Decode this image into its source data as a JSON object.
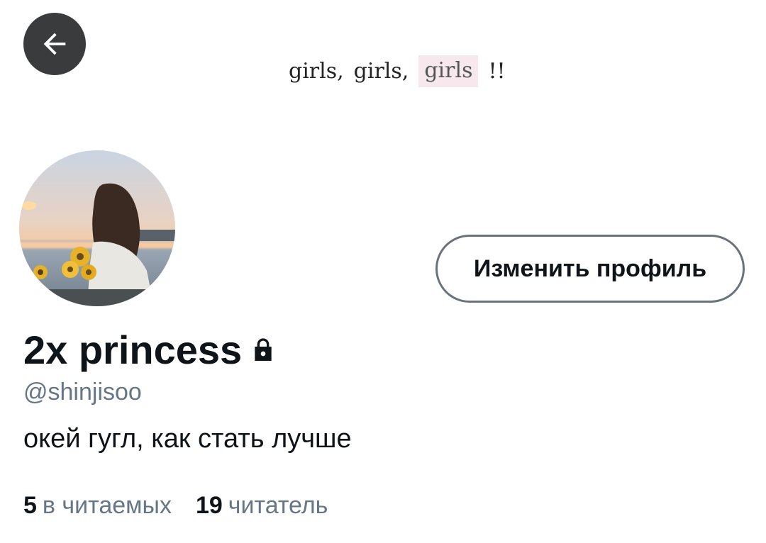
{
  "header": {
    "back_icon": "arrow-left-icon",
    "banner_words": [
      "girls,",
      "girls,",
      "girls",
      "!!"
    ]
  },
  "profile": {
    "avatar_alt": "avatar",
    "edit_button_label": "Изменить профиль",
    "display_name": "2x princess",
    "lock_icon": "lock-icon",
    "handle": "@shinjisoo",
    "bio": "окей гугл, как стать лучше"
  },
  "stats": {
    "following_count": "5",
    "following_label": "в читаемых",
    "followers_count": "19",
    "followers_label": "читатель"
  },
  "colors": {
    "accent_text": "#0f1419",
    "secondary_text": "#657786",
    "back_button_bg": "#3a3b3d",
    "banner_highlight": "#f6e8ec"
  }
}
